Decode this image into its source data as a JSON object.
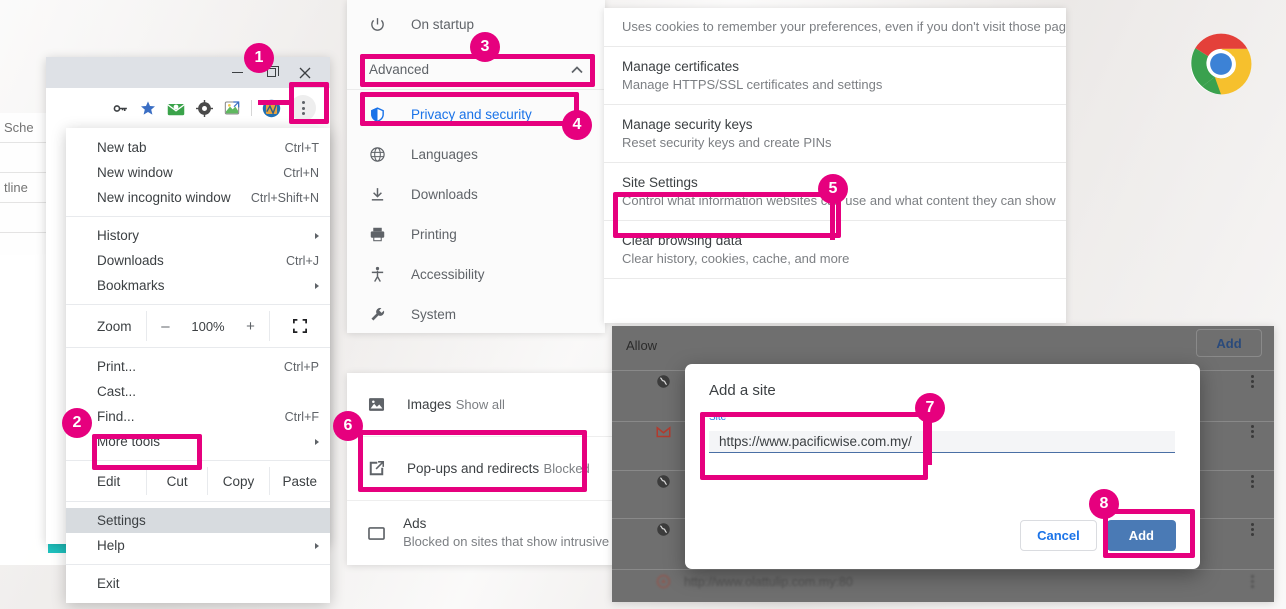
{
  "background_page": {
    "rows": [
      {
        "text": "Sche"
      },
      {
        "text": "tline"
      }
    ],
    "dark_card_lines": [
      "M",
      "M"
    ]
  },
  "chrome_window": {
    "titlebar": {
      "minimize_label": "minimize",
      "maximize_label": "restore",
      "close_label": "close"
    },
    "toolbar_icons": [
      "key-icon",
      "star-icon",
      "mail-extension-icon",
      "gear-extension-icon",
      "image-extension-icon",
      "profile-avatar-icon",
      "kebab-menu-icon"
    ]
  },
  "chrome_menu": {
    "items": [
      {
        "label": "New tab",
        "accel": "Ctrl+T",
        "submenu": false
      },
      {
        "label": "New window",
        "accel": "Ctrl+N",
        "submenu": false
      },
      {
        "label": "New incognito window",
        "accel": "Ctrl+Shift+N",
        "submenu": false
      }
    ],
    "items2": [
      {
        "label": "History",
        "accel": "",
        "submenu": true
      },
      {
        "label": "Downloads",
        "accel": "Ctrl+J",
        "submenu": false
      },
      {
        "label": "Bookmarks",
        "accel": "",
        "submenu": true
      }
    ],
    "zoom": {
      "label": "Zoom",
      "minus": "–",
      "value": "100%",
      "plus": "+",
      "fullscreen_icon": "fullscreen-icon"
    },
    "items3": [
      {
        "label": "Print...",
        "accel": "Ctrl+P",
        "submenu": false
      },
      {
        "label": "Cast...",
        "accel": "",
        "submenu": false
      },
      {
        "label": "Find...",
        "accel": "Ctrl+F",
        "submenu": false
      },
      {
        "label": "More tools",
        "accel": "",
        "submenu": true
      }
    ],
    "edit_row": {
      "label": "Edit",
      "cut": "Cut",
      "copy": "Copy",
      "paste": "Paste"
    },
    "items4": [
      {
        "label": "Settings",
        "accel": "",
        "submenu": false,
        "highlight": true
      },
      {
        "label": "Help",
        "accel": "",
        "submenu": true,
        "highlight": false
      }
    ],
    "items5": [
      {
        "label": "Exit",
        "accel": "",
        "submenu": false
      }
    ]
  },
  "settings_nav": {
    "top_item": {
      "label": "On startup",
      "icon": "power-icon"
    },
    "advanced": {
      "label": "Advanced",
      "icon": "chevron-up-icon"
    },
    "items": [
      {
        "label": "Privacy and security",
        "icon": "shield-icon",
        "active": true
      },
      {
        "label": "Languages",
        "icon": "globe-icon",
        "active": false
      },
      {
        "label": "Downloads",
        "icon": "download-icon",
        "active": false
      },
      {
        "label": "Printing",
        "icon": "printer-icon",
        "active": false
      },
      {
        "label": "Accessibility",
        "icon": "accessibility-icon",
        "active": false
      },
      {
        "label": "System",
        "icon": "wrench-icon",
        "active": false
      }
    ]
  },
  "settings_content": {
    "partial_row": {
      "subtitle": "Uses cookies to remember your preferences, even if you don't visit those pag"
    },
    "rows": [
      {
        "title": "Manage certificates",
        "subtitle": "Manage HTTPS/SSL certificates and settings"
      },
      {
        "title": "Manage security keys",
        "subtitle": "Reset security keys and create PINs"
      },
      {
        "title": "Site Settings",
        "subtitle": "Control what information websites can use and what content they can show"
      },
      {
        "title": "Clear browsing data",
        "subtitle": "Clear history, cookies, cache, and more"
      }
    ]
  },
  "site_settings_list": {
    "rows": [
      {
        "title": "Images",
        "subtitle": "Show all",
        "icon": "image-icon"
      },
      {
        "title": "Pop-ups and redirects",
        "subtitle": "Blocked",
        "icon": "popup-icon"
      },
      {
        "title": "Ads",
        "subtitle": "Blocked on sites that show intrusive",
        "icon": "ads-icon"
      }
    ]
  },
  "allow_section": {
    "heading": "Allow",
    "add_button": "Add",
    "sites": [
      {
        "url": "",
        "icon": "globe-favicon"
      },
      {
        "url": "",
        "icon": "gmail-favicon"
      },
      {
        "url": "",
        "icon": "globe-favicon"
      },
      {
        "url": "",
        "icon": "globe-favicon"
      },
      {
        "url": "http://www.olattulip.com.my:80",
        "icon": "red-favicon"
      }
    ]
  },
  "add_site_dialog": {
    "title": "Add a site",
    "field_label": "Site",
    "field_value": "https://www.pacificwise.com.my/",
    "field_placeholder": "",
    "cancel_label": "Cancel",
    "add_label": "Add"
  },
  "annotations": {
    "accent_color": "#E6007E",
    "badges": [
      {
        "n": "1"
      },
      {
        "n": "2"
      },
      {
        "n": "3"
      },
      {
        "n": "4"
      },
      {
        "n": "5"
      },
      {
        "n": "6"
      },
      {
        "n": "7"
      },
      {
        "n": "8"
      }
    ]
  },
  "chrome_logo": {
    "name": "google-chrome-logo"
  }
}
